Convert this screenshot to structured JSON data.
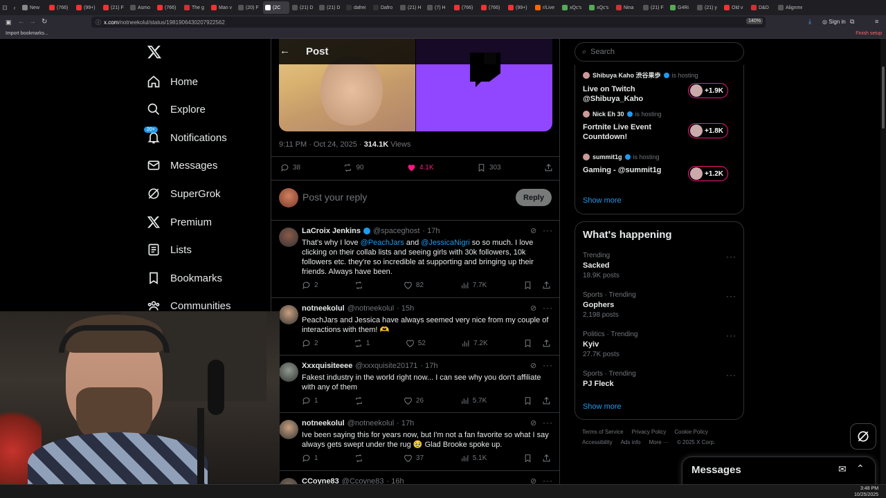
{
  "browser": {
    "tabs": [
      "New",
      "(766)",
      "(99+)",
      "(21) F",
      "Asmo",
      "(766)",
      "The g",
      "Man v",
      "(20) F",
      "(2C",
      "(21) D",
      "(21) D",
      "dafrei",
      "Dafro",
      "(21) H",
      "(7) H",
      "(766)",
      "(766)",
      "(99+)",
      "r/Live",
      "xQc's",
      "xQc's",
      "Nina",
      "(21) F",
      "G4Ri",
      "(21) y",
      "Old v",
      "D&D",
      "Alignment"
    ],
    "url_host": "x.com",
    "url_path": "/notneekolul/status/1981906430207922562",
    "zoom": "140%",
    "sign_in": "Sign in",
    "import_bookmarks": "Import bookmarks...",
    "finish_setup": "Finish setup"
  },
  "sidebar": {
    "items": [
      {
        "label": "Home",
        "icon": "home-icon"
      },
      {
        "label": "Explore",
        "icon": "search-icon"
      },
      {
        "label": "Notifications",
        "icon": "bell-icon",
        "badge": "20+"
      },
      {
        "label": "Messages",
        "icon": "mail-icon"
      },
      {
        "label": "SuperGrok",
        "icon": "grok-icon"
      },
      {
        "label": "Premium",
        "icon": "x-logo-icon"
      },
      {
        "label": "Lists",
        "icon": "list-icon"
      },
      {
        "label": "Bookmarks",
        "icon": "bookmark-icon"
      },
      {
        "label": "Communities",
        "icon": "communities-icon"
      }
    ]
  },
  "post": {
    "header_title": "Post",
    "timestamp": "9:11 PM · Oct 24, 2025 · ",
    "views_count": "314.1K",
    "views_label": " Views",
    "replies": "38",
    "reposts": "90",
    "likes": "4.1K",
    "bookmarks": "303",
    "reply_placeholder": "Post your reply",
    "reply_button": "Reply"
  },
  "replies": [
    {
      "prefix": "",
      "name": "LaCroix Jenkins",
      "verified": true,
      "handle": "@spaceghost",
      "time": "· 17h",
      "text": [
        [
          "That's why I love ",
          ""
        ],
        [
          "@PeachJars",
          "m"
        ],
        [
          " and ",
          ""
        ],
        [
          "@JessicaNigri",
          "m"
        ],
        [
          " so so much. I love clicking on their collab lists and seeing girls with 30k followers, 10k followers etc. they're so incredible at supporting and bringing up their friends. Always have been.",
          ""
        ]
      ],
      "replies": "2",
      "reposts": "",
      "likes": "82",
      "views": "7.7K",
      "avatar_color": "#8a5a4a"
    },
    {
      "prefix": "",
      "name": "notneekolul",
      "verified": false,
      "handle": "@notneekolul",
      "time": "· 15h",
      "text": [
        [
          "PeachJars and Jessica have always seemed very nice from my couple of interactions with them! 🫶",
          ""
        ]
      ],
      "replies": "2",
      "reposts": "1",
      "likes": "52",
      "views": "7.2K",
      "avatar_color": "#c9a080"
    },
    {
      "prefix": "",
      "name": "Xxxquisiteeee",
      "verified": false,
      "handle": "@xxxquisite20171",
      "time": "· 17h",
      "text": [
        [
          "Fakest industry in the world right now... I can see why you don't affiliate with any of them",
          ""
        ]
      ],
      "replies": "1",
      "reposts": "",
      "likes": "26",
      "views": "5.7K",
      "avatar_color": "#8f9a8f"
    },
    {
      "prefix": "",
      "name": "notneekolul",
      "verified": false,
      "handle": "@notneekolul",
      "time": "· 17h",
      "text": [
        [
          "Ive been saying this for years now, but I'm not a fan favorite so what I say always gets swept under the rug 🥹 Glad Brooke spoke up.",
          ""
        ]
      ],
      "replies": "1",
      "reposts": "",
      "likes": "37",
      "views": "5.1K",
      "avatar_color": "#c9a080"
    },
    {
      "prefix": "",
      "name": "CCoyne83",
      "verified": false,
      "handle": "@Ccoyne83",
      "time": "· 16h",
      "text": [],
      "replies": "",
      "reposts": "",
      "likes": "",
      "views": "",
      "avatar_color": "#7a6a5a"
    }
  ],
  "right": {
    "search_placeholder": "Search",
    "live": [
      {
        "name": "Shibuya Kaho 渋谷果歩",
        "hosting": "is hosting",
        "title": "Live on Twitch @Shibuya_Kaho",
        "count": "+1.9K"
      },
      {
        "name": "Nick Eh 30",
        "hosting": "is hosting",
        "title": "Fortnite Live Event Countdown!",
        "count": "+1.8K"
      },
      {
        "name": "summit1g",
        "hosting": "is hosting",
        "title": "Gaming - @summit1g",
        "count": "+1.2K"
      }
    ],
    "show_more": "Show more",
    "happening_title": "What's happening",
    "trends": [
      {
        "meta": "Trending",
        "title": "Sacked",
        "count": "18.9K posts"
      },
      {
        "meta": "Sports · Trending",
        "title": "Gophers",
        "count": "2,198 posts"
      },
      {
        "meta": "Politics · Trending",
        "title": "Kyiv",
        "count": "27.7K posts"
      },
      {
        "meta": "Sports · Trending",
        "title": "PJ Fleck",
        "count": ""
      }
    ],
    "show_more2": "Show more",
    "footer": [
      "Terms of Service",
      "Privacy Policy",
      "Cookie Policy",
      "Accessibility",
      "Ads info",
      "More ···",
      "© 2025 X Corp."
    ],
    "messages_label": "Messages"
  },
  "taskbar": {
    "time": "3:48 PM",
    "date": "10/25/2025"
  },
  "colors": {
    "accent": "#1d9bf0",
    "like": "#f91880",
    "twitch": "#9146ff"
  }
}
